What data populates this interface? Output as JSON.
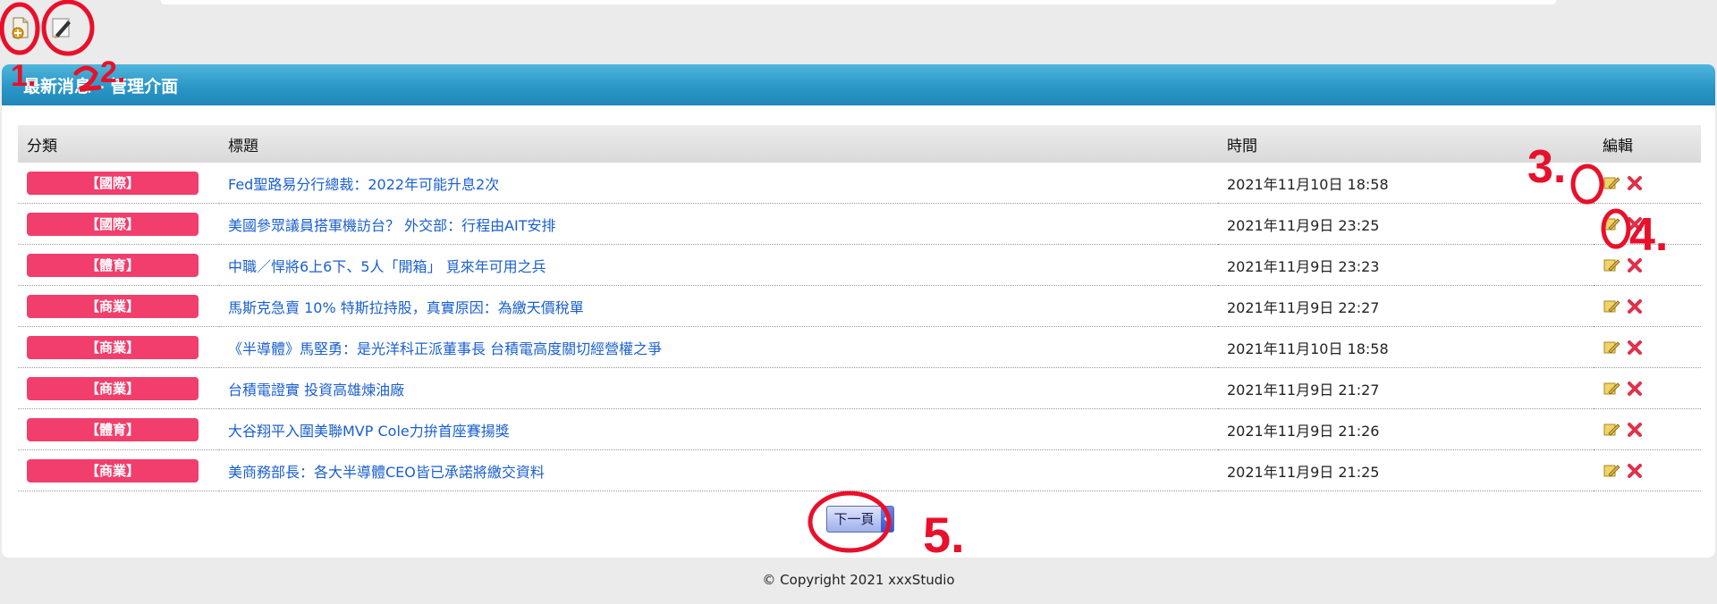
{
  "toolbar": {
    "add_icon": "add-news-icon",
    "edit_icon": "manage-pen-icon"
  },
  "panel": {
    "title": "最新消息 - 管理介面"
  },
  "table": {
    "headers": {
      "category": "分類",
      "title": "標題",
      "time": "時間",
      "edit": "編輯"
    },
    "rows": [
      {
        "category": "【國際】",
        "title": "Fed聖路易分行總裁：2022年可能升息2次",
        "time": "2021年11月10日 18:58"
      },
      {
        "category": "【國際】",
        "title": "美國參眾議員搭軍機訪台？ 外交部：行程由AIT安排",
        "time": "2021年11月9日 23:25"
      },
      {
        "category": "【體育】",
        "title": "中職／悍將6上6下、5人「開箱」 覓來年可用之兵",
        "time": "2021年11月9日 23:23"
      },
      {
        "category": "【商業】",
        "title": "馬斯克急賣 10% 特斯拉持股，真實原因：為繳天價稅單",
        "time": "2021年11月9日 22:27"
      },
      {
        "category": "【商業】",
        "title": "《半導體》馬堅勇：是光洋科正派董事長 台積電高度關切經營權之爭",
        "time": "2021年11月10日 18:58"
      },
      {
        "category": "【商業】",
        "title": "台積電證實 投資高雄煉油廠",
        "time": "2021年11月9日 21:27"
      },
      {
        "category": "【體育】",
        "title": "大谷翔平入圍美聯MVP Cole力拚首座賽揚獎",
        "time": "2021年11月9日 21:26"
      },
      {
        "category": "【商業】",
        "title": "美商務部長：各大半導體CEO皆已承諾將繳交資料",
        "time": "2021年11月9日 21:25"
      }
    ]
  },
  "pager": {
    "next_label": "下一頁"
  },
  "footer": {
    "copyright": "© Copyright 2021 xxxStudio"
  },
  "annotations": {
    "label_1": "1.",
    "label_2": "2.",
    "label_3": "3.",
    "label_4": "4.",
    "label_5": "5."
  },
  "colors": {
    "header_blue": "#2a97c7",
    "badge_pink": "#f23e6c",
    "link_blue": "#1a5fd0",
    "annotation_red": "#e8102a"
  }
}
